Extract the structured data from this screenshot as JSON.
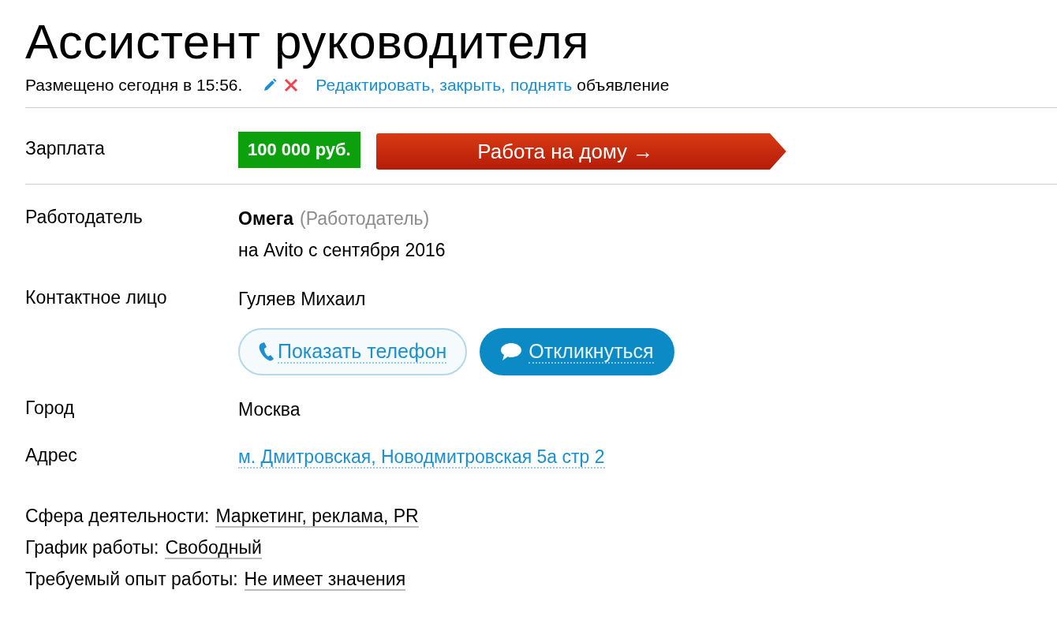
{
  "title": "Ассистент руководителя",
  "meta": {
    "posted": "Размещено сегодня в 15:56.",
    "actions": [
      "Редактировать,",
      "закрыть,",
      "поднять"
    ],
    "suffix": "объявление"
  },
  "salary": {
    "label": "Зарплата",
    "amount": "100 000 руб.",
    "category": "Работа на дому →"
  },
  "employer": {
    "label": "Работодатель",
    "name": "Омега",
    "type": "(Работодатель)",
    "since": "на Avito с сентября 2016"
  },
  "contact": {
    "label": "Контактное лицо",
    "name": "Гуляев Михаил"
  },
  "buttons": [
    {
      "kind": "phone",
      "label": "Показать телефон"
    },
    {
      "kind": "reply",
      "label": "Откликнуться"
    }
  ],
  "city": {
    "label": "Город",
    "value": "Москва"
  },
  "address": {
    "label": "Адрес",
    "value": "м. Дмитровская, Новодмитровская 5а стр 2"
  },
  "params": [
    {
      "label": "Сфера деятельности:",
      "value": "Маркетинг, реклама, PR"
    },
    {
      "label": "График работы:",
      "value": "Свободный"
    },
    {
      "label": "Требуемый опыт работы:",
      "value": "Не имеет значения"
    }
  ]
}
